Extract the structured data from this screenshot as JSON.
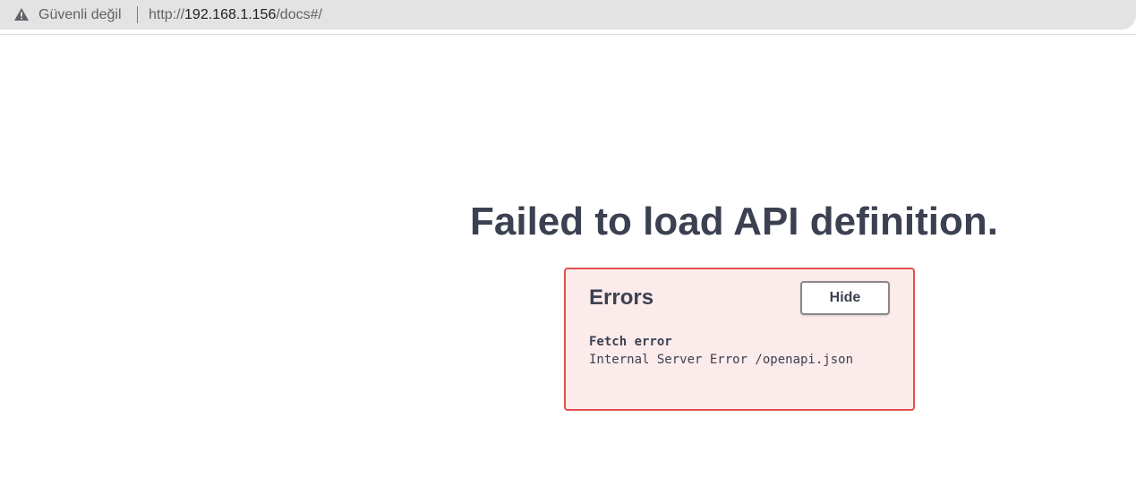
{
  "browser": {
    "security_label": "Güvenli değil",
    "url_prefix": "http://",
    "url_host": "192.168.1.156",
    "url_path": "/docs#/",
    "security_icon": "warning-triangle-icon"
  },
  "main": {
    "title": "Failed to load API definition."
  },
  "errors": {
    "heading": "Errors",
    "hide_label": "Hide",
    "items": [
      {
        "title": "Fetch error",
        "message": "Internal Server Error /openapi.json"
      }
    ]
  },
  "colors": {
    "error_border": "#e64f4f",
    "error_background": "#fcebeb",
    "text": "#3b4151"
  }
}
